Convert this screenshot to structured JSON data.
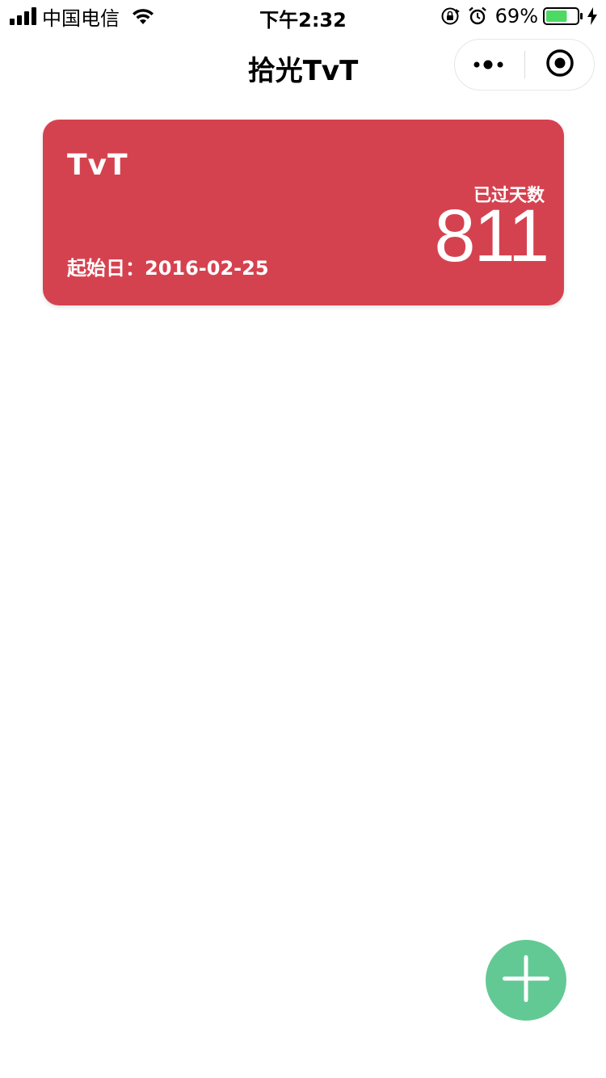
{
  "status_bar": {
    "carrier": "中国电信",
    "time": "下午2:32",
    "battery_percent": "69%",
    "battery_level": 0.69,
    "icons": [
      "signal-icon",
      "wifi-icon",
      "rotation-lock-icon",
      "alarm-icon",
      "battery-icon",
      "charging-icon"
    ]
  },
  "nav": {
    "title": "拾光TvT",
    "more_icon": "more-dots-icon",
    "close_icon": "target-circle-icon"
  },
  "card": {
    "title": "TvT",
    "start_label": "起始日：",
    "start_date": "2016-02-25",
    "days_label": "已过天数",
    "days_value": "811",
    "color": "#d5424f"
  },
  "fab": {
    "icon": "plus-icon",
    "color": "#62c994"
  }
}
